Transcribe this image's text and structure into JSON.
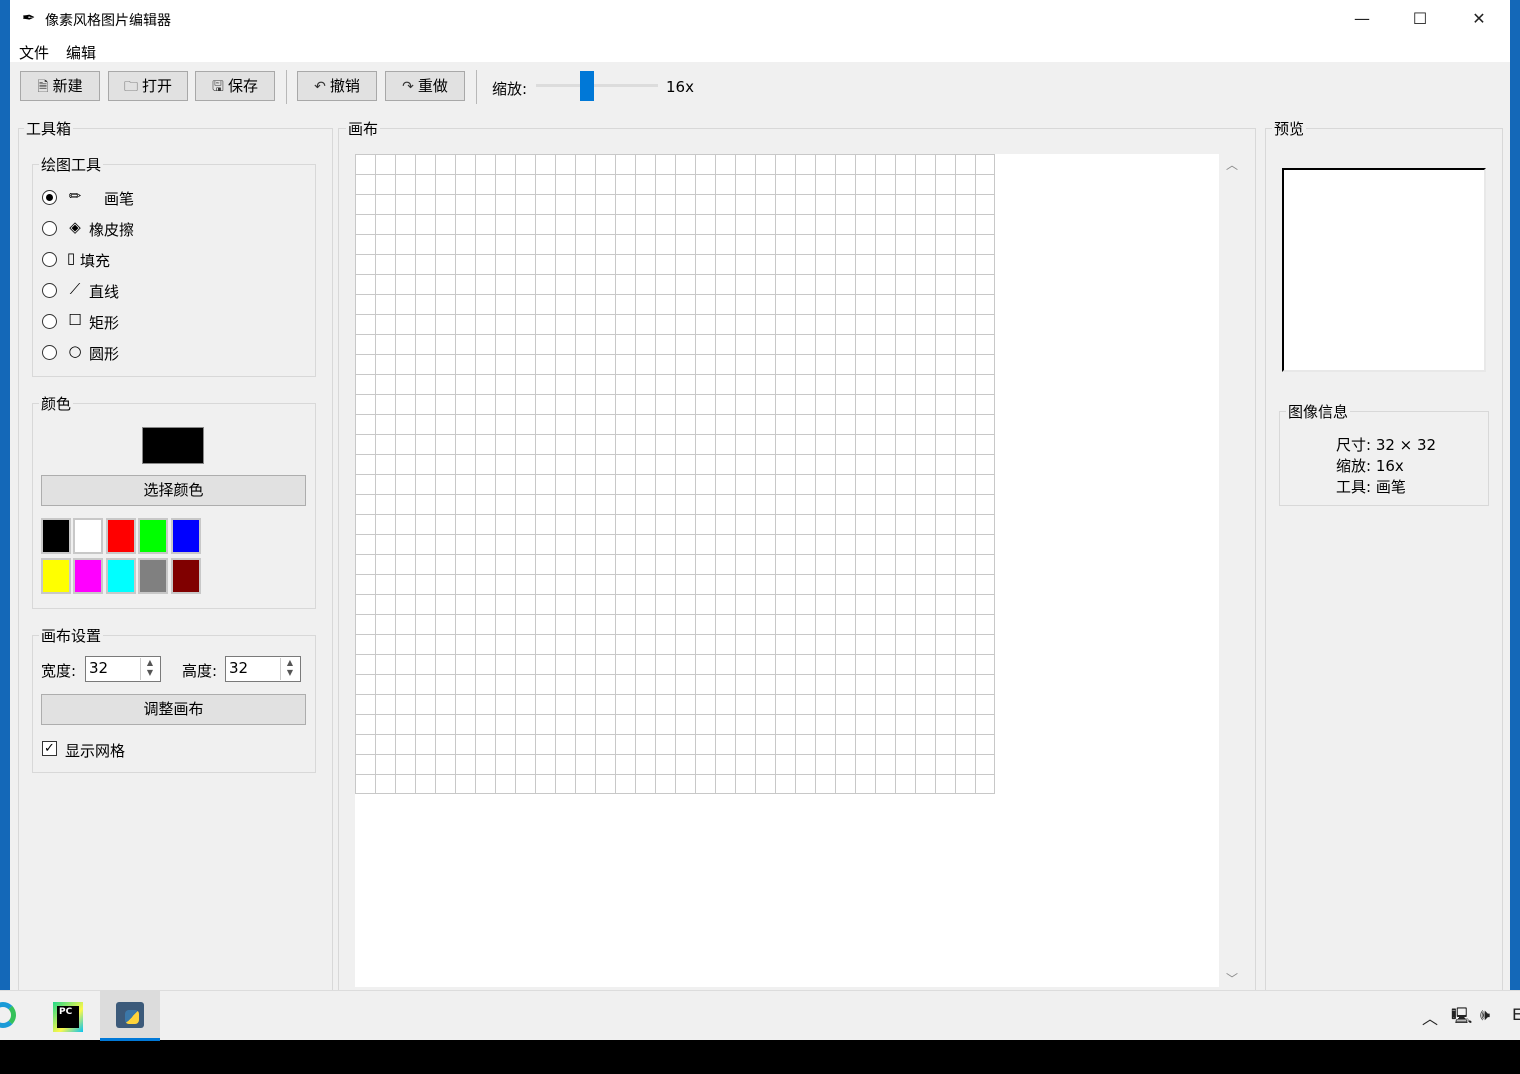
{
  "window": {
    "title": "像素风格图片编辑器"
  },
  "menu": {
    "file": "文件",
    "edit": "编辑"
  },
  "toolbar": {
    "new": "新建",
    "open": "打开",
    "save": "保存",
    "undo": "撤销",
    "redo": "重做",
    "zoom_label": "缩放:",
    "zoom_value": "16x"
  },
  "toolbox": {
    "title": "工具箱",
    "draw_tools_title": "绘图工具",
    "tools": [
      {
        "label": "画笔",
        "icon": "✏",
        "selected": true
      },
      {
        "label": "橡皮擦",
        "icon": "🩹",
        "selected": false
      },
      {
        "label": "填充",
        "icon": "▯",
        "selected": false
      },
      {
        "label": "直线",
        "icon": "📏",
        "selected": false
      },
      {
        "label": "矩形",
        "icon": "☐",
        "selected": false
      },
      {
        "label": "圆形",
        "icon": "⭕",
        "selected": false
      }
    ],
    "color_title": "颜色",
    "current_color": "#000000",
    "pick_color": "选择颜色",
    "palette": [
      "#000000",
      "#ffffff",
      "#ff0000",
      "#00ff00",
      "#0000ff",
      "#ffff00",
      "#ff00ff",
      "#00ffff",
      "#808080",
      "#800000"
    ],
    "canvas_settings_title": "画布设置",
    "width_label": "宽度:",
    "width_value": "32",
    "height_label": "高度:",
    "height_value": "32",
    "resize": "调整画布",
    "show_grid": "显示网格",
    "show_grid_checked": true
  },
  "canvas": {
    "title": "画布",
    "grid_cells": 32
  },
  "preview": {
    "title": "预览",
    "info_title": "图像信息",
    "size": "尺寸: 32 × 32",
    "zoom": "缩放: 16x",
    "tool": "工具: 画笔"
  },
  "taskbar": {
    "apps": [
      "edge-icon",
      "pycharm-icon",
      "python-icon"
    ],
    "tray_lang": "E"
  }
}
